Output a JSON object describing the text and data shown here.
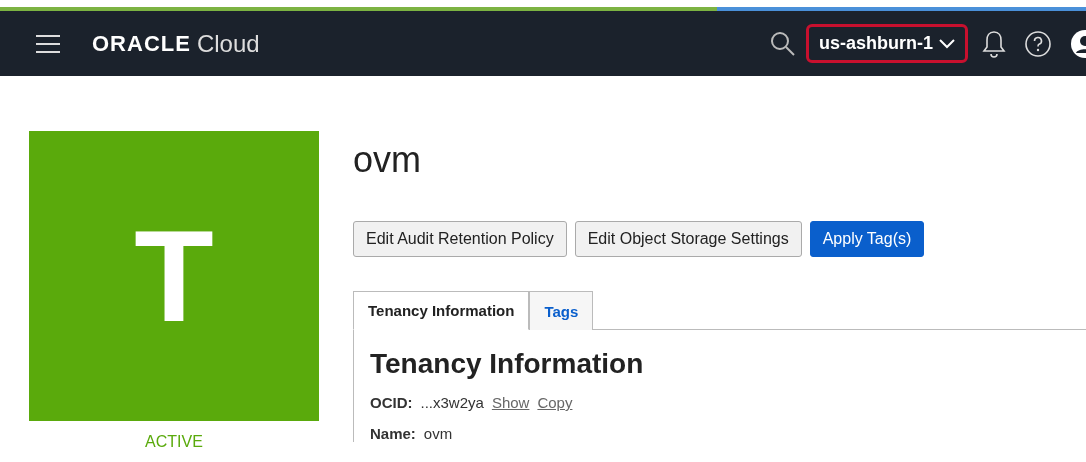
{
  "header": {
    "logo_brand": "ORACLE",
    "logo_product": "Cloud",
    "region": {
      "label": "us-ashburn-1",
      "highlighted": true
    }
  },
  "tenancy": {
    "avatar_letter": "T",
    "status": "ACTIVE",
    "name": "ovm"
  },
  "buttons": [
    {
      "label": "Edit Audit Retention Policy",
      "kind": "secondary"
    },
    {
      "label": "Edit Object Storage Settings",
      "kind": "secondary"
    },
    {
      "label": "Apply Tag(s)",
      "kind": "primary"
    }
  ],
  "tabs": [
    {
      "label": "Tenancy Information",
      "selected": true
    },
    {
      "label": "Tags",
      "selected": false
    }
  ],
  "panel": {
    "heading": "Tenancy Information",
    "fields": [
      {
        "label": "OCID:",
        "value": "...x3w2ya",
        "links": [
          "Show",
          "Copy"
        ]
      },
      {
        "label": "Name:",
        "value": "ovm"
      }
    ]
  }
}
